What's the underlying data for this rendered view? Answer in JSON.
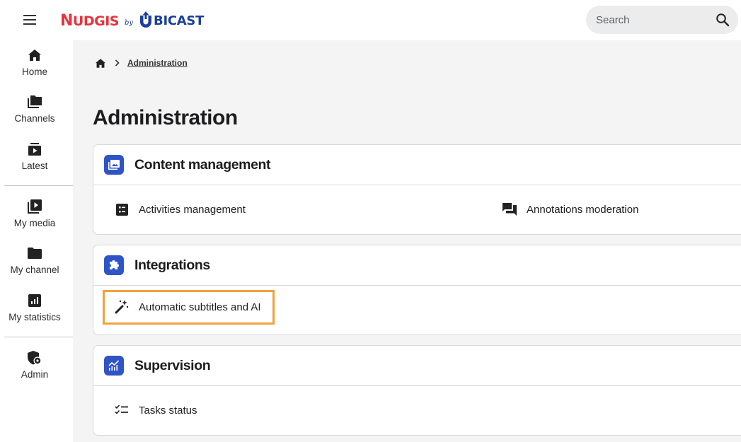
{
  "brand": {
    "name_first": "N",
    "name_rest": "UDGIS",
    "by": "by",
    "partner_first": "U",
    "partner_rest": "BICAST",
    "brand_color": "#e8333c",
    "partner_color": "#1b3f9a"
  },
  "search": {
    "placeholder": "Search"
  },
  "sidebar": {
    "items": [
      {
        "label": "Home",
        "icon": "home-icon"
      },
      {
        "label": "Channels",
        "icon": "channels-icon"
      },
      {
        "label": "Latest",
        "icon": "latest-icon"
      },
      {
        "label": "My media",
        "icon": "my-media-icon"
      },
      {
        "label": "My channel",
        "icon": "folder-icon"
      },
      {
        "label": "My statistics",
        "icon": "statistics-icon"
      },
      {
        "label": "Admin",
        "icon": "admin-shield-icon"
      }
    ]
  },
  "breadcrumb": {
    "current": "Administration"
  },
  "page_title": "Administration",
  "sections": [
    {
      "title": "Content management",
      "icon": "content-management-icon",
      "links": [
        {
          "label": "Activities management",
          "icon": "activities-icon"
        },
        {
          "label": "Annotations moderation",
          "icon": "annotations-icon"
        }
      ]
    },
    {
      "title": "Integrations",
      "icon": "puzzle-icon",
      "links": [
        {
          "label": "Automatic subtitles and AI",
          "icon": "magic-wand-icon",
          "highlighted": true
        }
      ]
    },
    {
      "title": "Supervision",
      "icon": "monitoring-icon",
      "links": [
        {
          "label": "Tasks status",
          "icon": "checklist-icon"
        }
      ]
    }
  ],
  "colors": {
    "accent": "#2f54c6",
    "highlight": "#f0a23c",
    "main_bg": "#f4f4f4"
  }
}
